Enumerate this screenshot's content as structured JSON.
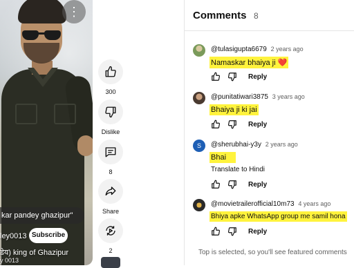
{
  "video": {
    "title_overlay": "kar pandey ghazipur\"",
    "channel_name": "ley0013",
    "subscribe_label": "Subscribe",
    "description": "डेय) king of Ghazipur",
    "description_sub": "y 0013"
  },
  "actions": {
    "like_count": "300",
    "dislike_label": "Dislike",
    "comment_count": "8",
    "share_label": "Share",
    "remix_count": "2"
  },
  "comments_panel": {
    "title": "Comments",
    "count": "8",
    "footer": "Top is selected, so you'll see featured comments",
    "comments": [
      {
        "author": "@tulasigupta6679",
        "time": "2 years ago",
        "text": "Namaskar bhaiya ji ❤️",
        "reply_label": "Reply",
        "avatar_color": "#7a9a5a"
      },
      {
        "author": "@punitatiwari3875",
        "time": "3 years ago",
        "text": "Bhaiya ji ki jai",
        "reply_label": "Reply",
        "avatar_color": "#8a6a5a"
      },
      {
        "author": "@sherubhai-y3y",
        "time": "2 years ago",
        "text": "Bhai",
        "translate_label": "Translate to Hindi",
        "reply_label": "Reply",
        "avatar_letter": "S",
        "avatar_color": "#1e5fb5"
      },
      {
        "author": "@movietrailerofficial10m73",
        "time": "4 years ago",
        "text": "Bhiya apke WhatsApp group me samil hona",
        "reply_label": "Reply",
        "avatar_color": "#2a2a2a"
      }
    ]
  },
  "colors": {
    "highlight": "#fff33d",
    "secondary_text": "#606060",
    "action_bg": "#f2f2f2"
  }
}
